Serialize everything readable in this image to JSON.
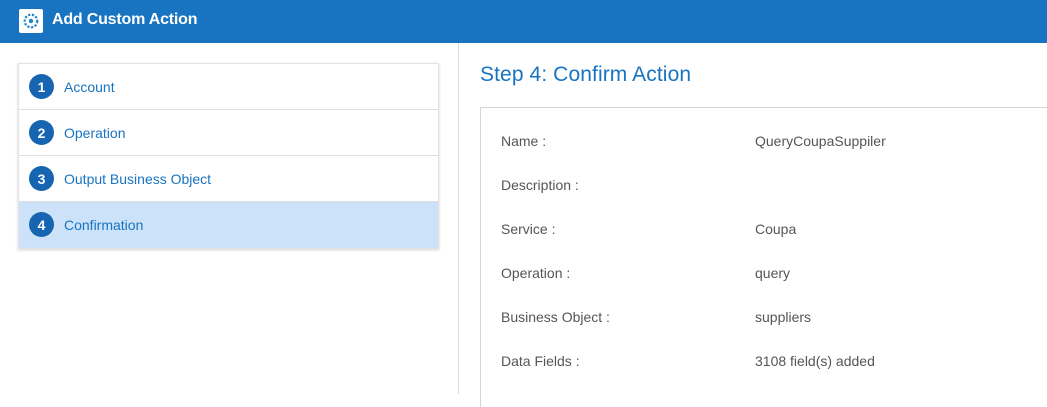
{
  "window": {
    "title": "Add Custom Action",
    "icon": "gear-logo-icon"
  },
  "steps": [
    {
      "number": "1",
      "label": "Account",
      "active": false
    },
    {
      "number": "2",
      "label": "Operation",
      "active": false
    },
    {
      "number": "3",
      "label": "Output Business Object",
      "active": false
    },
    {
      "number": "4",
      "label": "Confirmation",
      "active": true
    }
  ],
  "main": {
    "heading": "Step 4: Confirm Action",
    "fields": [
      {
        "key": "Name :",
        "value": "QueryCoupaSuppiler"
      },
      {
        "key": "Description :",
        "value": ""
      },
      {
        "key": "Service :",
        "value": "Coupa"
      },
      {
        "key": "Operation :",
        "value": "query"
      },
      {
        "key": "Business Object :",
        "value": "suppliers"
      },
      {
        "key": "Data Fields :",
        "value": "3108 field(s) added"
      }
    ]
  },
  "colors": {
    "accent": "#1874c1",
    "active_step_bg": "#cce2f8",
    "step_badge": "#1765b0"
  }
}
